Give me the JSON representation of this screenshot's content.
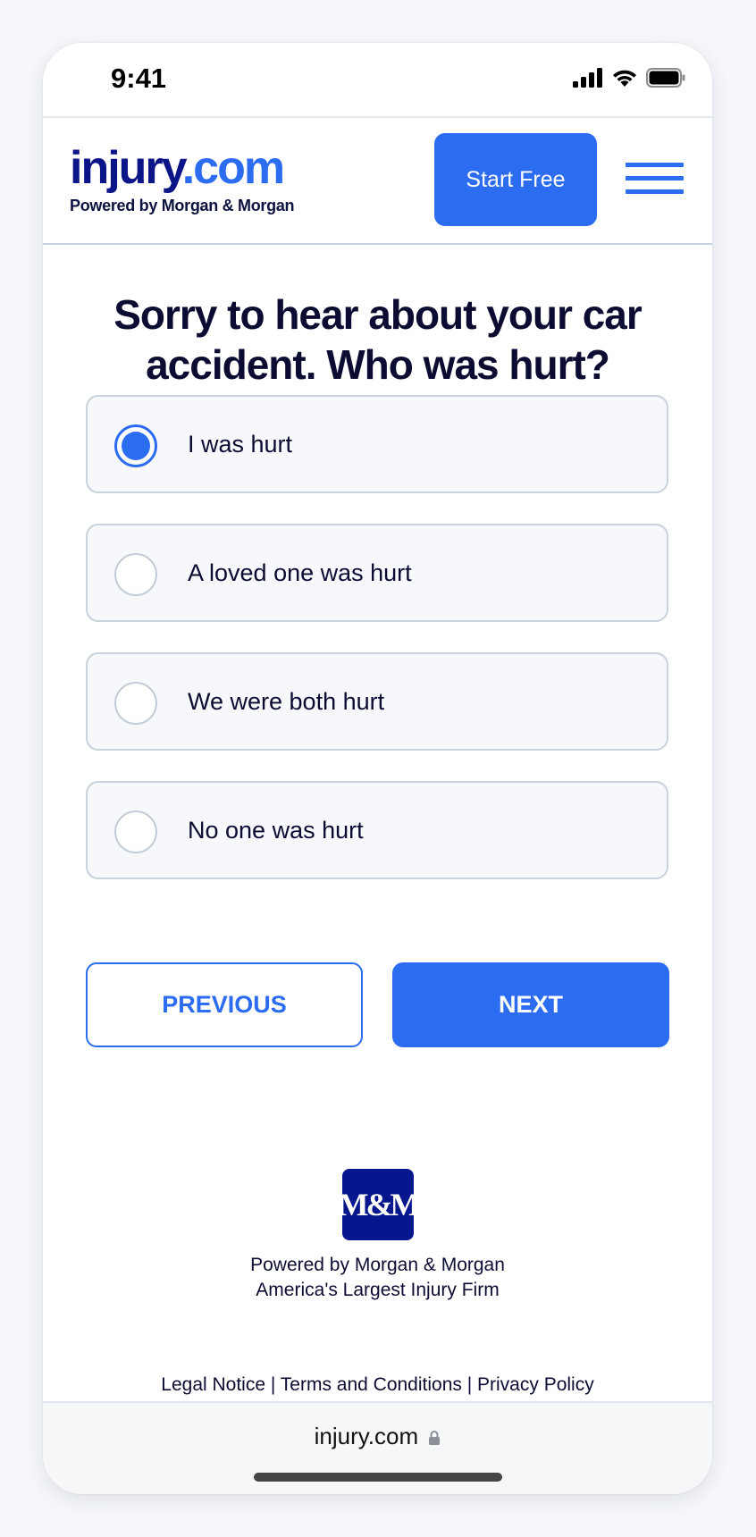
{
  "status_bar": {
    "time": "9:41",
    "icons": [
      "cellular-signal-icon",
      "wifi-icon",
      "battery-icon"
    ]
  },
  "header": {
    "logo_main": "injury",
    "logo_tld": ".com",
    "logo_subtitle": "Powered by Morgan & Morgan",
    "start_button": "Start Free",
    "menu_icon": "hamburger-menu-icon"
  },
  "question": {
    "line1": "Sorry to hear about your car",
    "line2": "accident. Who was hurt?"
  },
  "options": [
    {
      "label": "I was hurt",
      "selected": true
    },
    {
      "label": "A loved one was hurt",
      "selected": false
    },
    {
      "label": "We were both hurt",
      "selected": false
    },
    {
      "label": "No one was hurt",
      "selected": false
    }
  ],
  "navigation": {
    "previous_label": "PREVIOUS",
    "next_label": "NEXT"
  },
  "footer": {
    "firm_logo": "M&M",
    "powered_by": "Powered by Morgan & Morgan",
    "tagline": "America's Largest Injury Firm",
    "links": [
      "Legal Notice",
      "Terms and Conditions",
      "Privacy Policy"
    ],
    "separator": " | "
  },
  "browser": {
    "url": "injury.com",
    "lock_icon": "lock-icon"
  },
  "colors": {
    "brand_blue": "#2c6cf0",
    "navy": "#0b1587",
    "text_dark": "#0c0c32",
    "border": "#c9d2dd"
  }
}
